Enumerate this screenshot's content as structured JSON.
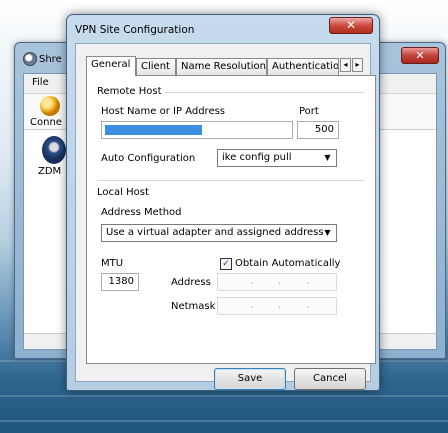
{
  "background_window": {
    "title": "Shre",
    "menu_file": "File",
    "toolbar_connect": "Conne",
    "site_label": "ZDM",
    "close_glyph": "✕"
  },
  "dialog": {
    "title": "VPN Site Configuration",
    "close_glyph": "✕",
    "tabs": [
      "General",
      "Client",
      "Name Resolution",
      "Authenticatio"
    ],
    "tab_scroll_left": "◂",
    "tab_scroll_right": "▸",
    "remote_host": {
      "group_label": "Remote Host",
      "host_label": "Host Name or IP Address",
      "host_fill_fraction": 0.52,
      "port_label": "Port",
      "port_value": "500",
      "auto_config_label": "Auto Configuration",
      "auto_config_value": "ike config pull"
    },
    "local_host": {
      "group_label": "Local Host",
      "address_method_label": "Address Method",
      "address_method_value": "Use a virtual adapter and assigned address",
      "mtu_label": "MTU",
      "mtu_value": "1380",
      "obtain_auto_label": "Obtain Automatically",
      "obtain_auto_checked": true,
      "check_glyph": "✓",
      "address_label": "Address",
      "netmask_label": "Netmask",
      "ip_dots": "."
    },
    "buttons": {
      "save": "Save",
      "cancel": "Cancel"
    }
  },
  "colors": {
    "accent_fill": "#3b8ee0",
    "close_red": "#c2433a"
  }
}
